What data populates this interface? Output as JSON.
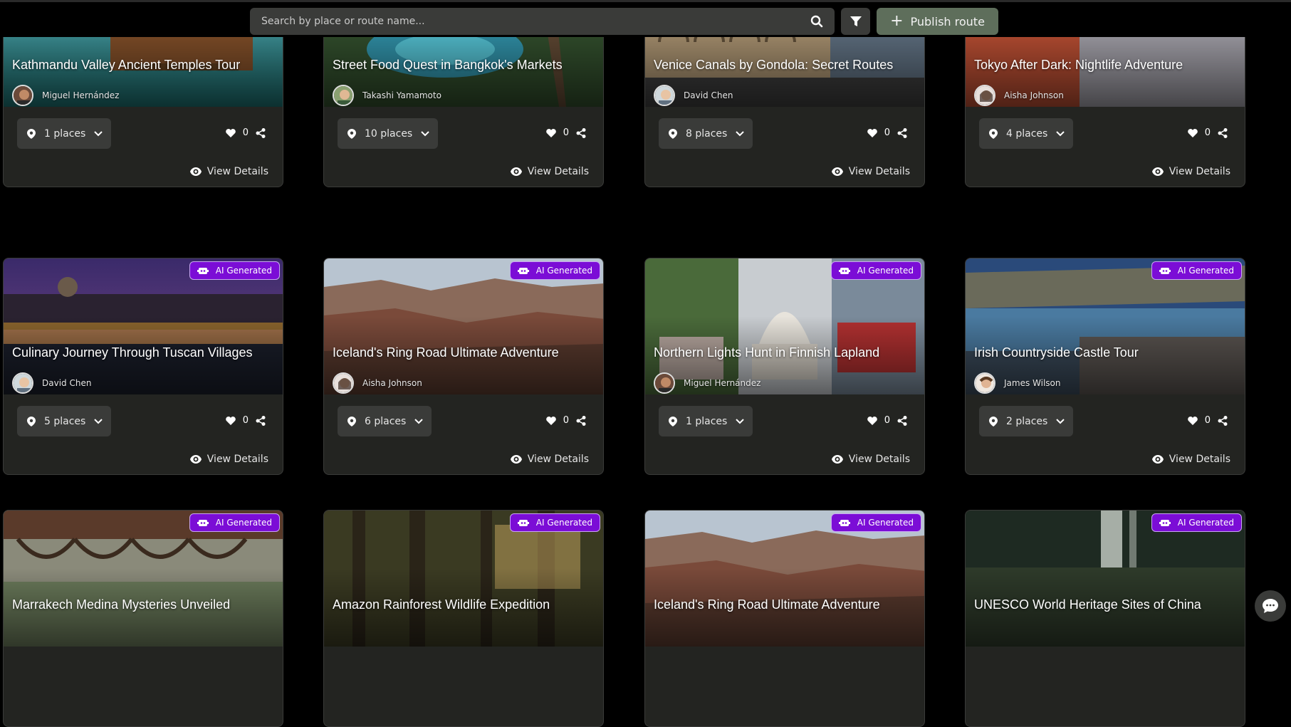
{
  "search": {
    "placeholder": "Search by place or route name..."
  },
  "toolbar": {
    "publish_label": "Publish route"
  },
  "common": {
    "view_details": "View Details",
    "ai_badge": "AI Generated"
  },
  "cards": [
    {
      "title": "Kathmandu Valley Ancient Temples Tour",
      "author": "Miguel Hernández",
      "places": "1 places",
      "likes": "0",
      "ai": false
    },
    {
      "title": "Street Food Quest in Bangkok's Markets",
      "author": "Takashi Yamamoto",
      "places": "10 places",
      "likes": "0",
      "ai": false
    },
    {
      "title": "Venice Canals by Gondola: Secret Routes",
      "author": "David Chen",
      "places": "8 places",
      "likes": "0",
      "ai": false
    },
    {
      "title": "Tokyo After Dark: Nightlife Adventure",
      "author": "Aisha Johnson",
      "places": "4 places",
      "likes": "0",
      "ai": false
    },
    {
      "title": "Culinary Journey Through Tuscan Villages",
      "author": "David Chen",
      "places": "5 places",
      "likes": "0",
      "ai": true
    },
    {
      "title": "Iceland's Ring Road Ultimate Adventure",
      "author": "Aisha Johnson",
      "places": "6 places",
      "likes": "0",
      "ai": true
    },
    {
      "title": "Northern Lights Hunt in Finnish Lapland",
      "author": "Miguel Hernández",
      "places": "1 places",
      "likes": "0",
      "ai": true
    },
    {
      "title": "Irish Countryside Castle Tour",
      "author": "James Wilson",
      "places": "2 places",
      "likes": "0",
      "ai": true
    },
    {
      "title": "Marrakech Medina Mysteries Unveiled",
      "author": "",
      "places": "",
      "likes": "",
      "ai": true
    },
    {
      "title": "Amazon Rainforest Wildlife Expedition",
      "author": "",
      "places": "",
      "likes": "",
      "ai": true
    },
    {
      "title": "Iceland's Ring Road Ultimate Adventure",
      "author": "",
      "places": "",
      "likes": "",
      "ai": true
    },
    {
      "title": "UNESCO World Heritage Sites of China",
      "author": "",
      "places": "",
      "likes": "",
      "ai": true
    }
  ],
  "colors": {
    "background": "#000000",
    "card": "#232421",
    "control": "#3a3b39",
    "publish": "#5e6e5b",
    "ai_badge": "#7b0dd6"
  },
  "icons": [
    "search-icon",
    "filter-icon",
    "plus-icon",
    "map-pin-icon",
    "chevron-down-icon",
    "heart-icon",
    "share-icon",
    "eye-icon",
    "robot-icon",
    "chat-icon"
  ]
}
